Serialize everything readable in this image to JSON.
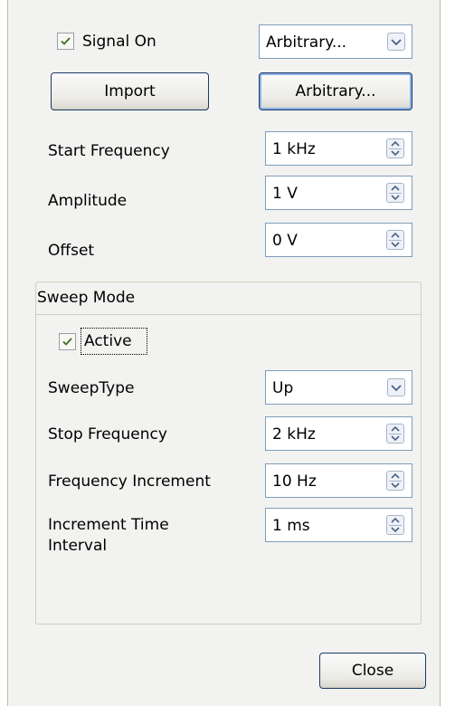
{
  "signal": {
    "checkbox_label": "Signal On",
    "checked": true,
    "waveform_select": "Arbitrary..."
  },
  "buttons": {
    "import_label": "Import",
    "arbitrary_label": "Arbitrary...",
    "close_label": "Close"
  },
  "fields": [
    {
      "label": "Start Frequency",
      "value": "1 kHz"
    },
    {
      "label": "Amplitude",
      "value": "1 V"
    },
    {
      "label": "Offset",
      "value": "0 V"
    }
  ],
  "sweep": {
    "group_title": "Sweep Mode",
    "active_label": "Active",
    "active_checked": true,
    "sweep_type_label": "SweepType",
    "sweep_type_value": "Up",
    "stop_frequency_label": "Stop Frequency",
    "stop_frequency_value": "2 kHz",
    "frequency_increment_label": "Frequency Increment",
    "frequency_increment_value": "10 Hz",
    "increment_time_label_line1": "Increment Time",
    "increment_time_label_line2": "Interval",
    "increment_time_value": "1 ms"
  },
  "icons": {
    "checkmark": "check-icon",
    "spinner": "spinner-arrows-icon",
    "dropdown": "chevron-down-icon"
  },
  "colors": {
    "window_bg": "#f2f2f0",
    "field_border": "#7f9db9",
    "button_border": "#1c3a63"
  }
}
